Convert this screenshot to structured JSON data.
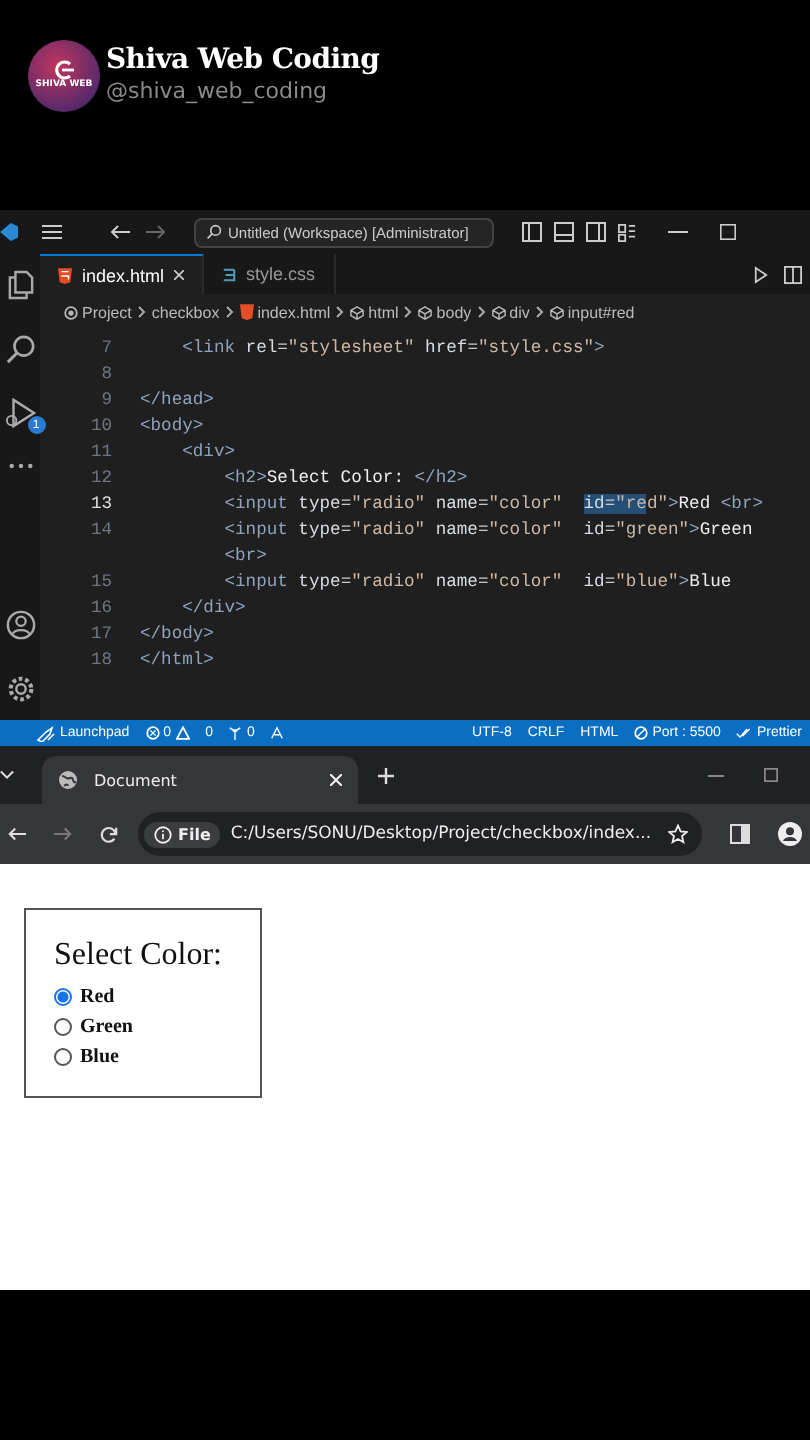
{
  "channel": {
    "avatar_text": "SHIVA WEB",
    "name": "Shiva Web Coding",
    "handle": "@shiva_web_coding"
  },
  "editor": {
    "title": "Untitled (Workspace) [Administrator]",
    "tabs": [
      {
        "label": "index.html",
        "kind": "html",
        "selected": true
      },
      {
        "label": "style.css",
        "kind": "css",
        "selected": false
      }
    ],
    "breadcrumb": [
      {
        "label": "Project",
        "kind": "root"
      },
      {
        "label": "checkbox",
        "kind": "folder"
      },
      {
        "label": "index.html",
        "kind": "html"
      },
      {
        "label": "html",
        "kind": "element"
      },
      {
        "label": "body",
        "kind": "element"
      },
      {
        "label": "div",
        "kind": "element"
      },
      {
        "label": "input#red",
        "kind": "element"
      }
    ],
    "debug_badge": "1",
    "lines": [
      {
        "number": "7",
        "current": false,
        "tokens": [
          {
            "kind": "tag",
            "text": "    <link"
          },
          {
            "kind": "attr",
            "text": " rel"
          },
          {
            "kind": "punct",
            "text": "="
          },
          {
            "kind": "str",
            "text": "\"stylesheet\""
          },
          {
            "kind": "attr",
            "text": " href"
          },
          {
            "kind": "punct",
            "text": "="
          },
          {
            "kind": "str",
            "text": "\"style.css\""
          },
          {
            "kind": "tag",
            "text": ">"
          }
        ]
      },
      {
        "number": "8",
        "current": false
      },
      {
        "number": "9",
        "current": false,
        "tokens": [
          {
            "kind": "tag",
            "text": "</head>"
          }
        ]
      },
      {
        "number": "10",
        "current": false,
        "tokens": [
          {
            "kind": "tag",
            "text": "<body>"
          }
        ]
      },
      {
        "number": "11",
        "current": false,
        "tokens": [
          {
            "kind": "tag",
            "text": "    <div>"
          }
        ]
      },
      {
        "number": "12",
        "current": false,
        "tokens": [
          {
            "kind": "tag",
            "text": "        <h2>"
          },
          {
            "kind": "text",
            "text": "Select Color: "
          },
          {
            "kind": "tag",
            "text": "</h2>"
          }
        ]
      },
      {
        "number": "13",
        "current": true,
        "tokens": [
          {
            "kind": "tag",
            "text": "        <input",
            "highlighted": false
          },
          {
            "kind": "attr",
            "text": " type",
            "highlighted": false
          },
          {
            "kind": "punct",
            "text": "=",
            "highlighted": false
          },
          {
            "kind": "str",
            "text": "\"radio\"",
            "highlighted": false
          },
          {
            "kind": "attr",
            "text": " name",
            "highlighted": false
          },
          {
            "kind": "punct",
            "text": "=",
            "highlighted": false
          },
          {
            "kind": "str",
            "text": "\"color\"  ",
            "highlighted": false
          },
          {
            "kind": "attr",
            "text": "id",
            "highlighted": true
          },
          {
            "kind": "punct",
            "text": "=",
            "highlighted": true
          },
          {
            "kind": "str",
            "text": "\"re",
            "highlighted": true
          },
          {
            "kind": "str",
            "text": "d\"",
            "highlighted": false
          },
          {
            "kind": "tag",
            "text": ">",
            "highlighted": false
          },
          {
            "kind": "text",
            "text": "Red ",
            "highlighted": false
          },
          {
            "kind": "tag",
            "text": "<br>",
            "highlighted": false
          }
        ]
      },
      {
        "number": "14",
        "current": false,
        "tokens": [
          {
            "kind": "tag",
            "text": "        <input"
          },
          {
            "kind": "attr",
            "text": " type"
          },
          {
            "kind": "punct",
            "text": "="
          },
          {
            "kind": "str",
            "text": "\"radio\""
          },
          {
            "kind": "attr",
            "text": " name"
          },
          {
            "kind": "punct",
            "text": "="
          },
          {
            "kind": "str",
            "text": "\"color\""
          },
          {
            "kind": "attr",
            "text": "  id"
          },
          {
            "kind": "punct",
            "text": "="
          },
          {
            "kind": "str",
            "text": "\"green\""
          },
          {
            "kind": "tag",
            "text": ">"
          },
          {
            "kind": "text",
            "text": "Green"
          }
        ]
      },
      {
        "tokens": [
          {
            "kind": "tag",
            "text": "        <br>"
          }
        ]
      },
      {
        "number": "15",
        "current": false,
        "tokens": [
          {
            "kind": "tag",
            "text": "        <input"
          },
          {
            "kind": "attr",
            "text": " type"
          },
          {
            "kind": "punct",
            "text": "="
          },
          {
            "kind": "str",
            "text": "\"radio\""
          },
          {
            "kind": "attr",
            "text": " name"
          },
          {
            "kind": "punct",
            "text": "="
          },
          {
            "kind": "str",
            "text": "\"color\""
          },
          {
            "kind": "attr",
            "text": "  id"
          },
          {
            "kind": "punct",
            "text": "="
          },
          {
            "kind": "str",
            "text": "\"blue\""
          },
          {
            "kind": "tag",
            "text": ">"
          },
          {
            "kind": "text",
            "text": "Blue"
          }
        ]
      },
      {
        "number": "16",
        "current": false,
        "tokens": [
          {
            "kind": "tag",
            "text": "    </div>"
          }
        ]
      },
      {
        "number": "17",
        "current": false,
        "tokens": [
          {
            "kind": "tag",
            "text": "</body>"
          }
        ]
      },
      {
        "number": "18",
        "current": false,
        "tokens": [
          {
            "kind": "tag",
            "text": "</html>"
          }
        ]
      }
    ],
    "status_bar": [
      {
        "kind": "launchpad",
        "text": "Launchpad"
      },
      {
        "kind": "errors",
        "text": "0"
      },
      {
        "kind": "warnings",
        "text": "0"
      },
      {
        "kind": "ports",
        "text": "0"
      },
      {
        "kind": "share"
      },
      {
        "kind": "spacer"
      },
      {
        "kind": "plain",
        "text": "UTF-8"
      },
      {
        "kind": "plain",
        "text": "CRLF"
      },
      {
        "kind": "plain",
        "text": "HTML"
      },
      {
        "kind": "port",
        "text": "Port : 5500"
      },
      {
        "kind": "prettier",
        "text": "Prettier"
      }
    ]
  },
  "browser": {
    "tab": {
      "title": "Document"
    },
    "address": {
      "scheme": "File",
      "url": "C:/Users/SONU/Desktop/Project/checkbox/index..."
    },
    "page": {
      "heading": "Select Color:",
      "options": [
        {
          "label": "Red",
          "selected": true
        },
        {
          "label": "Green",
          "selected": false
        },
        {
          "label": "Blue",
          "selected": false
        }
      ]
    }
  }
}
